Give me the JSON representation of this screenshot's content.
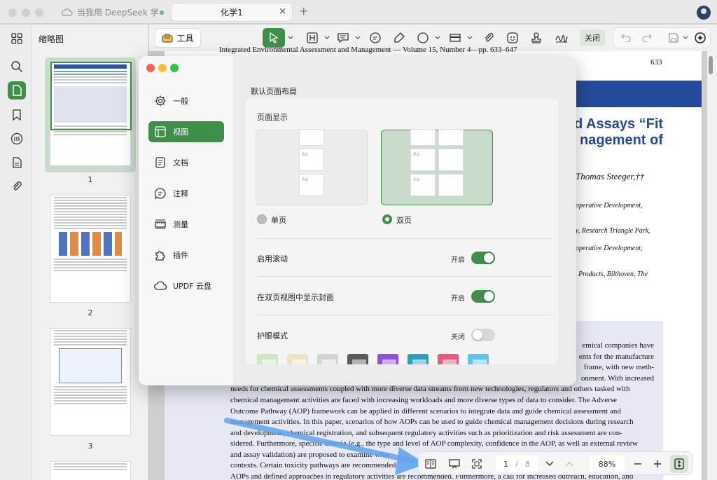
{
  "titlebar": {
    "tabs": [
      {
        "label": "当我用 DeepSeek 学习"
      },
      {
        "label": "化学1"
      }
    ],
    "close_glyph": "×",
    "add_glyph": "+"
  },
  "icons": {
    "rail": [
      "grid-icon",
      "search-icon",
      "file-icon",
      "bookmark-icon",
      "comment-icon",
      "attachment-icon",
      "paperclip-icon"
    ]
  },
  "sidebar": {
    "title": "缩略图",
    "pages": [
      "1",
      "2",
      "3"
    ]
  },
  "toolbar": {
    "tools_label": "工具",
    "close_label": "关闭"
  },
  "document": {
    "header": "Integrated Environmental Assessment and Management — Volume 15, Number 4—pp. 633–647",
    "page_number": "633",
    "title_line1": "d Assays “Fit",
    "title_line2": "nagement of",
    "author": "Thomas Steeger,††",
    "affil": [
      "operative Development,",
      "y, Research Triangle Park,",
      "operative Development,",
      "Products, Bilthoven, The"
    ],
    "abstract_partial": [
      "emical companies have",
      "ents for the manufacture",
      "frame, with new meth-",
      "onment. With increased"
    ],
    "abstract": [
      "needs for chemical assessments coupled with more diverse data streams from new technologies, regulators and others tasked with",
      "chemical management activities are faced with increasing workloads and more diverse types of data to consider. The Adverse",
      "Outcome Pathway (AOP) framework can be applied in different scenarios to integrate data and guide chemical assessment and",
      "management activities. In this paper, scenarios of how AOPs can be used to guide chemical management decisions during research",
      "and development, chemical registration, and subsequent regulatory activities such as prioritization and risk assessment are con-",
      "sidered. Furthermore, specific criteria (e.g., the type and level of AOP complexity, confidence in the AOP, as well as external review",
      "and assay validation) are proposed to examine what",
      "contexts. Certain toxicity pathways are recommended",
      "AOPs and defined approaches in regulatory activities are recommended. Furthermore, a call for increased outreach, education, and"
    ]
  },
  "settings": {
    "nav": [
      {
        "label": "一般",
        "icon": "gear-icon"
      },
      {
        "label": "视图",
        "icon": "layout-icon"
      },
      {
        "label": "文档",
        "icon": "document-icon"
      },
      {
        "label": "注释",
        "icon": "comment-icon"
      },
      {
        "label": "测量",
        "icon": "ruler-icon"
      },
      {
        "label": "插件",
        "icon": "puzzle-icon"
      },
      {
        "label": "UPDF 云盘",
        "icon": "cloud-icon"
      }
    ],
    "section_title": "默认页面布局",
    "page_display_label": "页面显示",
    "single_label": "单页",
    "double_label": "双页",
    "mini_page_text": "Aa",
    "scroll_label": "启用滚动",
    "scroll_state": "开启",
    "cover_label": "在双页视图中显示封面",
    "cover_state": "开启",
    "eye_label": "护眼模式",
    "eye_state": "关闭",
    "eye_colors": [
      "#cfe6c5",
      "#efe1c4",
      "#d4d4d4",
      "#5a5a5a",
      "#8f4ee0",
      "#2aa0b8",
      "#e85a82",
      "#5fc3ef"
    ]
  },
  "bottombar": {
    "page_current": "1",
    "page_sep": "/",
    "page_total": "8",
    "zoom": "88%"
  }
}
